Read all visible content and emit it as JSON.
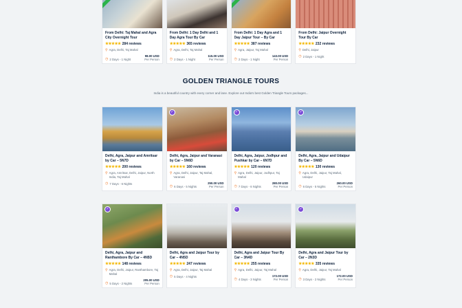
{
  "top_cards": [
    {
      "title": "From Delhi: Taj Mahal and Agra City Overnight Tour",
      "reviews": "284 reviews",
      "places": "Agra, Delhi, Taj Mahal",
      "duration": "2 Days - 1 Night",
      "price_amount": "98.00 USD",
      "price_unit": "Per Person",
      "ribbon": true
    },
    {
      "title": "From Delhi: 1 Day Delhi and 1 Day Agra Tour By Car",
      "reviews": "365 reviews",
      "places": "Agra, Delhi, Taj Mahal",
      "duration": "2 Days - 1 Night",
      "price_amount": "115.00 USD",
      "price_unit": "Per Person",
      "ribbon": false
    },
    {
      "title": "From Delhi: 1 Day Agra and 1 Day Jaipur Tour – By Car",
      "reviews": "387 reviews",
      "places": "Agra, Jaipur, Taj Mahal",
      "duration": "2 Days - 1 Night",
      "price_amount": "143.00 USD",
      "price_unit": "Per Person",
      "ribbon": true
    },
    {
      "title": "From Delhi: Jaipur Overnight Tour By Car",
      "reviews": "232 reviews",
      "places": "Delhi, Jaipur",
      "duration": "2 Days - 1 Night",
      "price_amount": "",
      "price_unit": "",
      "ribbon": false
    }
  ],
  "section": {
    "heading": "GOLDEN TRIANGLE TOURS",
    "subheading": "India is a beautiful country with every corner and lane. Explore out India's best Golden Triangle Tours packages..."
  },
  "row1_cards": [
    {
      "title": "Delhi, Agra, Jaipur and Amritsar by Car – 5N7D",
      "reviews": "200 reviews",
      "places": "Agra, Amritsar, Delhi, Jaipur, North India, Taj Mahal",
      "duration": "7 Days - 6 Nights",
      "price_amount": "",
      "price_unit": ""
    },
    {
      "title": "Delhi, Agra, Jaipur and Varanasi by Car – 5N6D",
      "reviews": "160 reviews",
      "places": "Agra, Delhi, Jaipur, Taj Mahal, Varanasi",
      "duration": "6 Days - 5 Nights",
      "price_amount": "250.00 USD",
      "price_unit": "Per Person"
    },
    {
      "title": "Delhi, Agra, Jaipur, Jodhpur and Pushkar by Car – 6N7D",
      "reviews": "120 reviews",
      "places": "Agra, Delhi, Jaipur, Jodhpur, Taj Mahal",
      "duration": "7 Days - 6 Nights",
      "price_amount": "280.00 USD",
      "price_unit": "Per Person"
    },
    {
      "title": "Delhi, Agra, Jaipur and Udaipur By Car – 5N6D",
      "reviews": "130 reviews",
      "places": "Agra, Delhi, Jaipur, Taj Mahal, Udaipur",
      "duration": "6 Days - 5 Nights",
      "price_amount": "260.00 USD",
      "price_unit": "Per Person"
    }
  ],
  "row2_cards": [
    {
      "title": "Delhi, Agra, Jaipur and Ranthambore By Car – 4N5D",
      "reviews": "148 reviews",
      "places": "Agra, Delhi, Jaipur, Ranthambore, Taj Mahal",
      "duration": "5 Days - 2 Nights",
      "price_amount": "205.00 USD",
      "price_unit": "Per Person"
    },
    {
      "title": "Delhi, Agra and Jaipur Tour by Car – 4N5D",
      "reviews": "247 reviews",
      "places": "Agra, Delhi, Jaipur, Taj Mahal",
      "duration": "5 Days - 4 Nights",
      "price_amount": "",
      "price_unit": ""
    },
    {
      "title": "Delhi, Agra and Jaipur Tour By Car – 3N4D",
      "reviews": "255 reviews",
      "places": "Agra, Delhi, Jaipur, Taj Mahal",
      "duration": "4 Days - 3 Nights",
      "price_amount": "172.00 USD",
      "price_unit": "Per Person"
    },
    {
      "title": "Delhi, Agra and Jaipur Tour by Car – 2N3D",
      "reviews": "335 reviews",
      "places": "Agra, Delhi, Jaipur, Taj Mahal",
      "duration": "3 Days - 2 Nights",
      "price_amount": "172.00 USD",
      "price_unit": "Per Person"
    }
  ],
  "icons": {
    "star": "star-icon",
    "location": "location-pin-icon",
    "clock": "clock-icon",
    "badge": "verified-badge-icon"
  },
  "colors": {
    "accent": "#f07c2e",
    "star": "#f2b600",
    "ribbon": "#2bb34a",
    "badge": "#7b4bd8",
    "title": "#0b1f3a"
  }
}
